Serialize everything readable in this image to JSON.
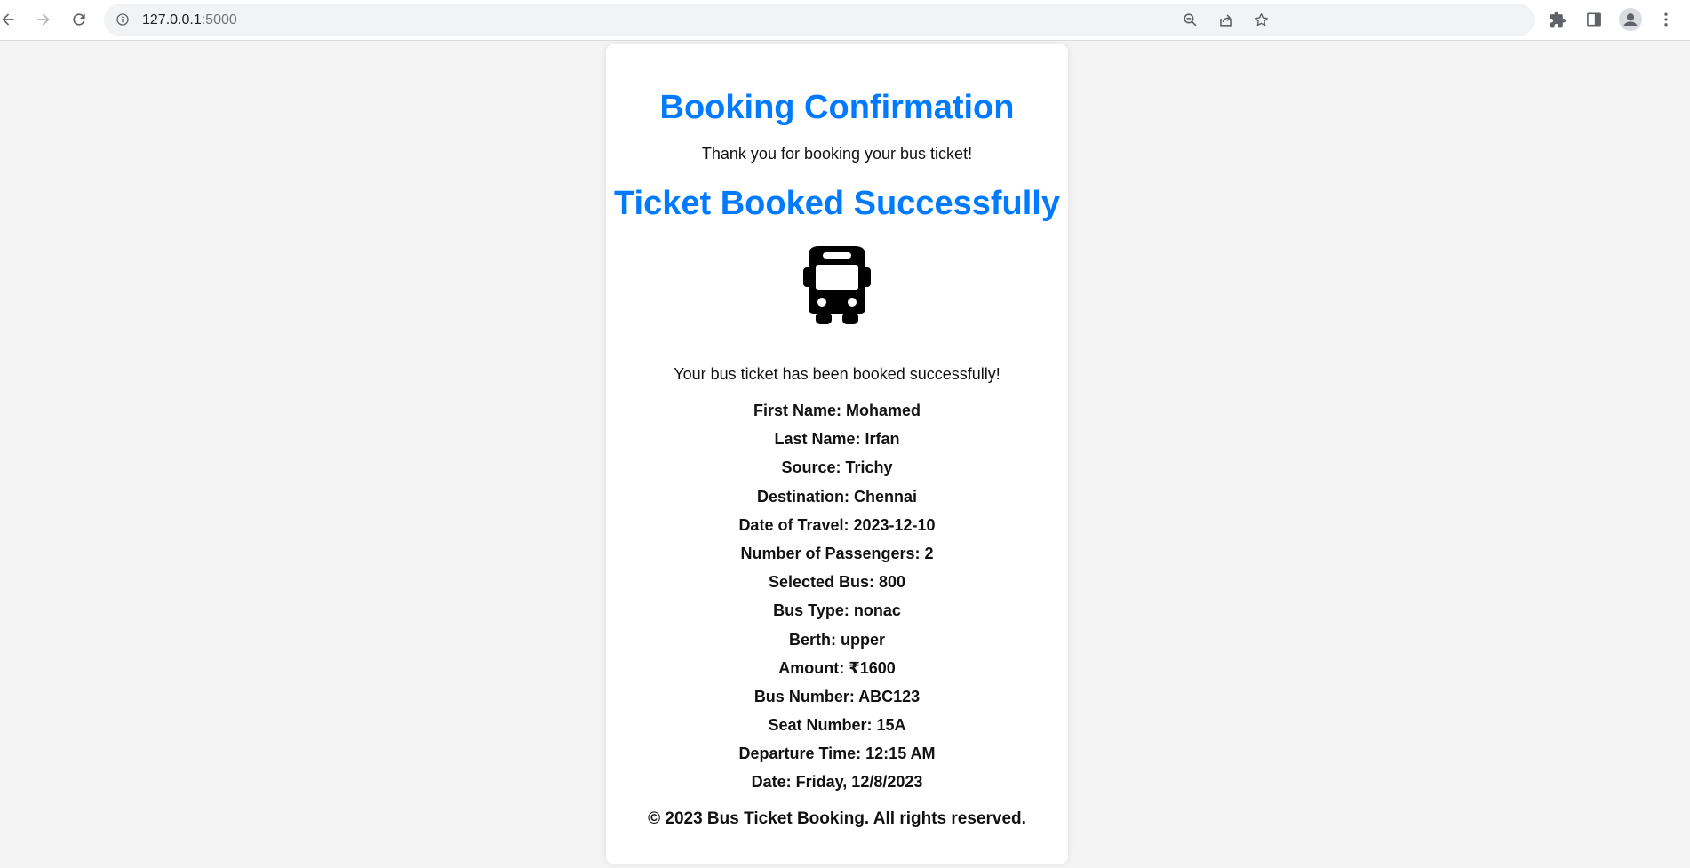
{
  "browser": {
    "url_host": "127.0.0.1",
    "url_port": ":5000",
    "icons": [
      "back-icon",
      "forward-icon",
      "reload-icon",
      "info-icon",
      "zoom-out-icon",
      "share-icon",
      "star-icon",
      "extensions-icon",
      "side-panel-icon",
      "profile-icon",
      "menu-icon"
    ]
  },
  "page": {
    "heading": "Booking Confirmation",
    "thanks": "Thank you for booking your bus ticket!",
    "subheading": "Ticket Booked Successfully",
    "bus_icon": "bus-icon",
    "success_message": "Your bus ticket has been booked successfully!",
    "details": [
      "First Name: Mohamed",
      "Last Name: Irfan",
      "Source: Trichy",
      "Destination: Chennai",
      "Date of Travel: 2023-12-10",
      "Number of Passengers: 2",
      "Selected Bus: 800",
      "Bus Type: nonac",
      "Berth: upper",
      "Amount: ₹1600",
      "Bus Number: ABC123",
      "Seat Number: 15A",
      "Departure Time: 12:15 AM",
      "Date: Friday, 12/8/2023"
    ],
    "footer": "© 2023 Bus Ticket Booking. All rights reserved."
  },
  "colors": {
    "heading": "#007bff",
    "background": "#f4f4f4",
    "card": "#ffffff"
  }
}
